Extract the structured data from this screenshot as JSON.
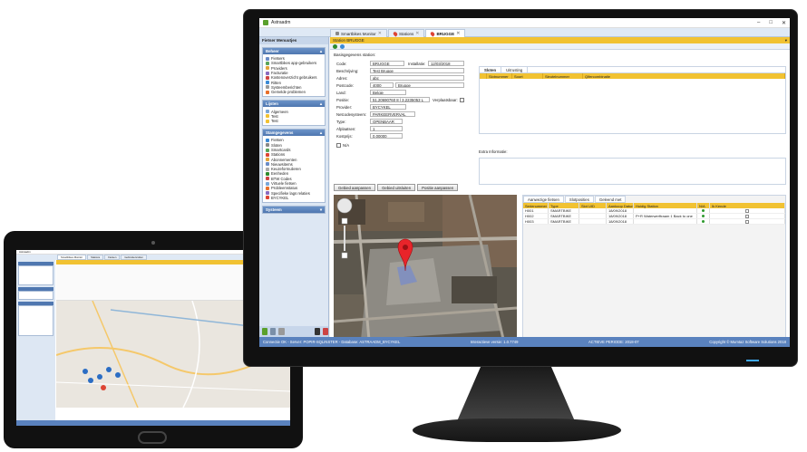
{
  "window": {
    "title": "Astraadm",
    "minimize": "–",
    "maximize": "□",
    "close": "✕"
  },
  "tabs": [
    {
      "label": "Smartbikes Monitor",
      "close": "✕"
    },
    {
      "label": "Stations",
      "close": "✕"
    },
    {
      "label": "BRUGGE",
      "close": "✕"
    }
  ],
  "sidebar": {
    "header": "Fietser Menuutjes",
    "beheer": {
      "title": "Beheer",
      "items": [
        "Fietsers",
        "Smartbikes app-gebruikers",
        "Providers",
        "Facturatie",
        "Kostenoverzicht gebruikers",
        "Ritten",
        "Systeemberichten",
        "Gemelde problemen"
      ]
    },
    "lijsten": {
      "title": "Lijsten",
      "items": [
        "Algemeen",
        "Test",
        "Test"
      ]
    },
    "stamgegevens": {
      "title": "Stamgegevens",
      "items": [
        "Fietsen",
        "Sloten",
        "Smartcards",
        "Stations",
        "Abonnementen",
        "Nieuwsitems",
        "Keuzeformulieren",
        "Eenheden",
        "BTW Codes",
        "Virtuele fietsen",
        "Probleemstatus",
        "Specifieke lags relaties",
        "BYCYKEL"
      ]
    },
    "systeem": {
      "title": "Systeem"
    }
  },
  "content": {
    "station_label": "Station BRUGGE",
    "section_title": "Basisgegevens station:",
    "fields": {
      "code_label": "Code:",
      "code": "BRUGGE",
      "installatie_label": "Installatie:",
      "installatie": "12/03/2018",
      "beschrijving_label": "Beschrijving:",
      "beschrijving": "Test Brugge",
      "adres_label": "Adres:",
      "adres": "abc",
      "postcode_label": "Postcode:",
      "postcode": "4000",
      "gemeente": "Brugge",
      "land_label": "Land:",
      "land": "Belgie",
      "positie_label": "Positie:",
      "positie": "51.20690760 8 | 3.2235053 L",
      "verplaatsbaar_label": "Verplaatsbaar:",
      "provider_label": "Provider:",
      "provider": "BYCYKEL",
      "netcode_label": "Netcodesysteem:",
      "netcode": "PARKEERVERVAL",
      "type_label": "Type:",
      "type": "OPENBAAR",
      "afplaatsen_label": "Afplaatsen:",
      "afplaatsen": "1",
      "kostprijs_label": "Kostprijs:",
      "kostprijs": "0,00000",
      "na_label": "N/A"
    },
    "right_tabs": [
      "Sloten",
      "Uitrusting"
    ],
    "sloten_columns": [
      "Slotnummer",
      "Soort",
      "Sleutelnummer",
      "Qifercombinatie"
    ],
    "extra_label": "Extra Informatie:",
    "buttons": [
      "Gebied aanpassen",
      "Gebied uitsluiten",
      "Positie aanpassen"
    ]
  },
  "list": {
    "tabs": [
      "Aanwezige fietsen",
      "Slotposities",
      "Geleend met"
    ],
    "columns": [
      "Serienummer",
      "Type",
      "Slot UID",
      "Aankoop Datum",
      "Huidig Station",
      "N/A",
      "Ik Kende"
    ],
    "rows": [
      {
        "serial": "H001",
        "type": "SMARTBIKE",
        "slot": "",
        "date": "18/09/2018",
        "station": ""
      },
      {
        "serial": "H002",
        "type": "SMARTBIKE",
        "slot": "",
        "date": "18/09/2018",
        "station": "P+R Waterwerftraam 1 Back to one"
      },
      {
        "serial": "H003",
        "type": "SMARTBIKE",
        "slot": "",
        "date": "18/09/2018",
        "station": ""
      }
    ]
  },
  "statusbar": {
    "connection": "Connectie OK - Server: POPIR-SQLINSTER - Database: ASTRAADM_BYCYKEL",
    "version": "Interactieve versie: 1.0.7749",
    "periode": "ACTIEVE PERIODE: 2018-07",
    "copyright": "Copyright © Mumtaz Software Solutions 2018"
  },
  "tablet": {
    "title": "Astraadm",
    "tabs": [
      "Smartbikes Monitor",
      "Stations",
      "Fietsen",
      "Gebruikersrollen"
    ]
  },
  "colors": {
    "accent_yellow": "#f1c232",
    "panel_blue": "#4f77b0",
    "status_blue": "#5a82be"
  }
}
